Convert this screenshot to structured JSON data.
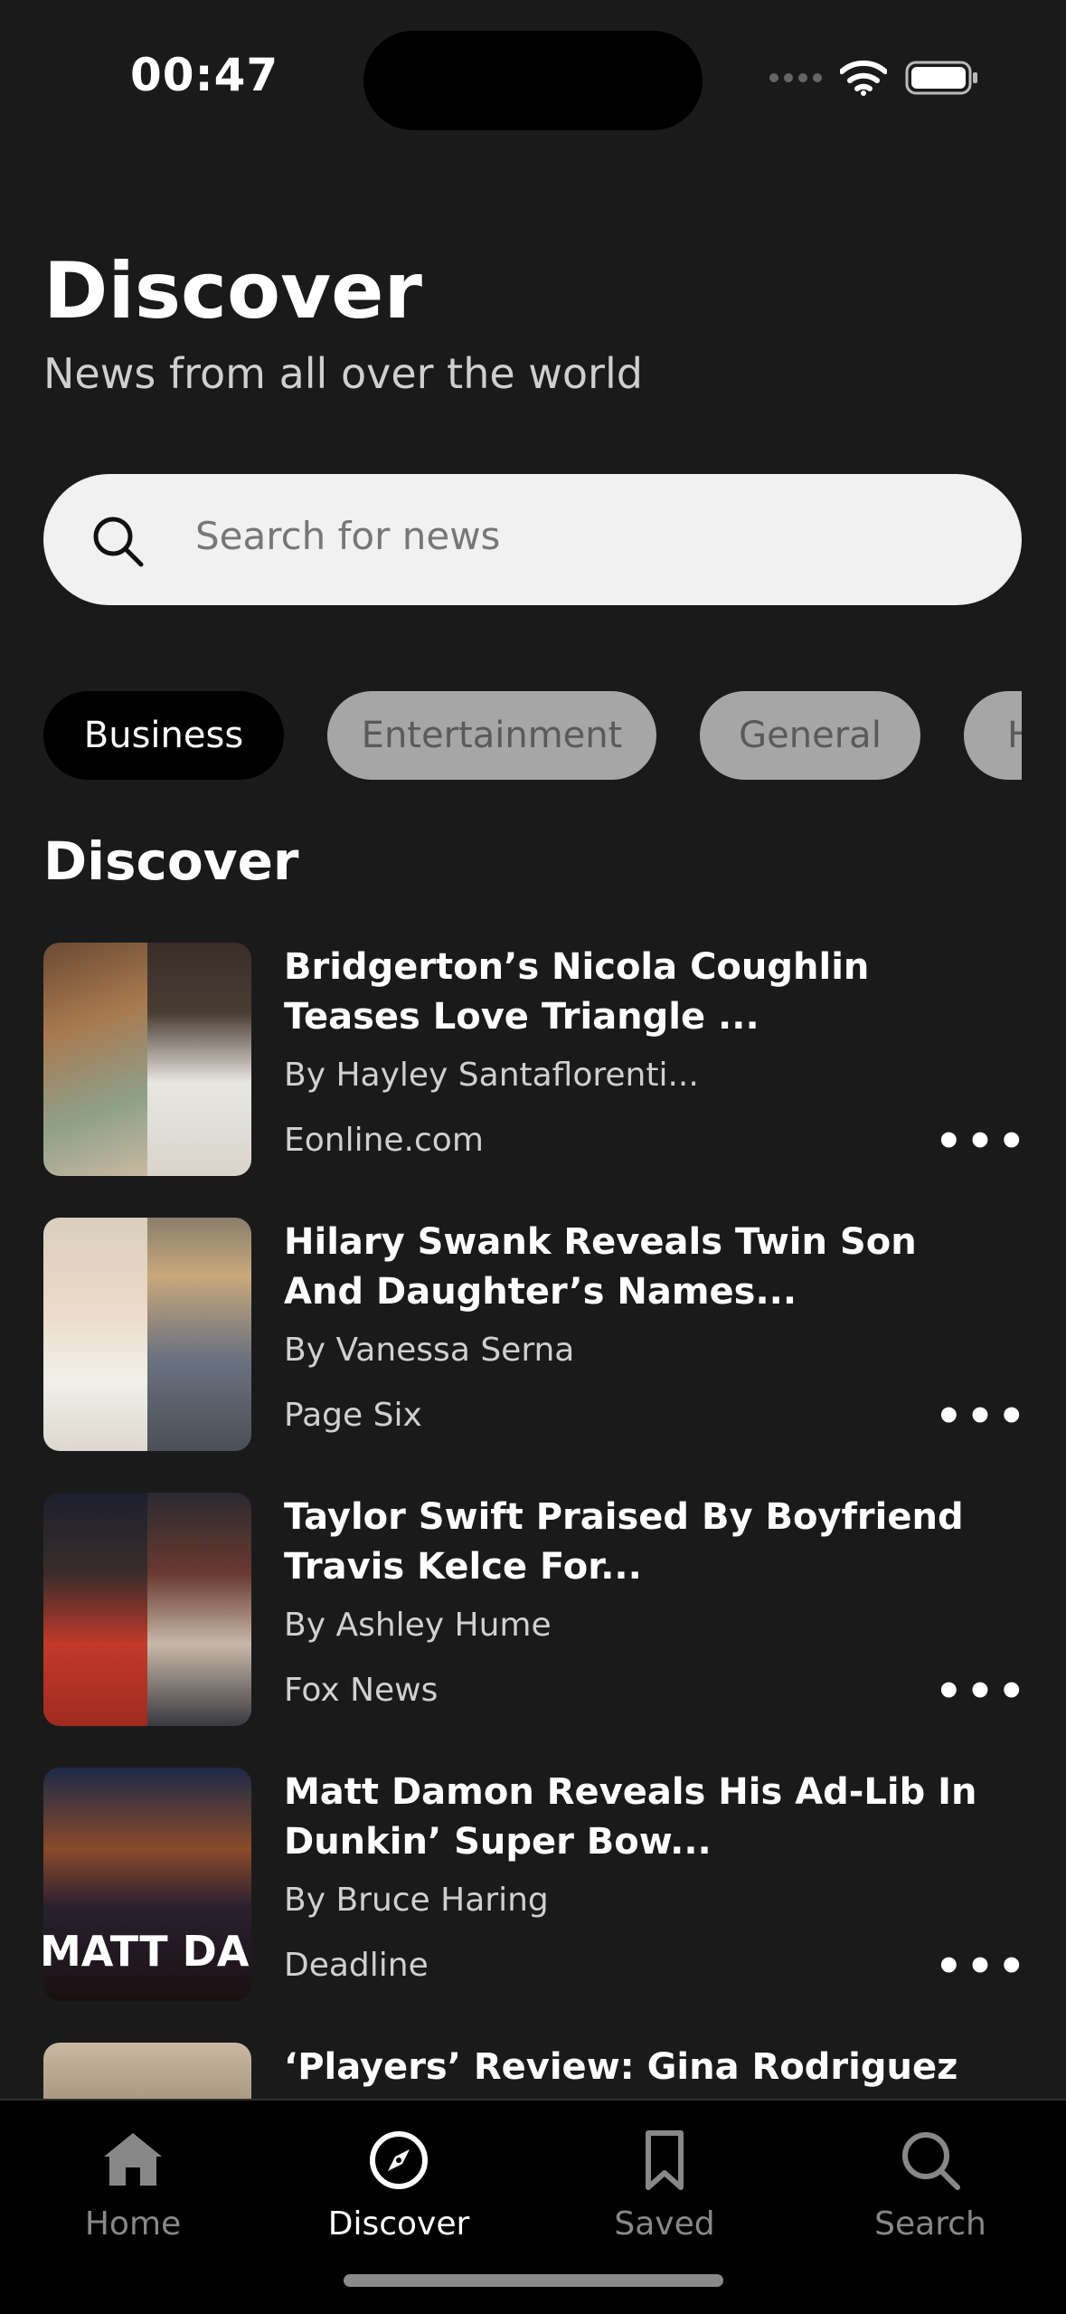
{
  "status": {
    "time": "00:47"
  },
  "header": {
    "title": "Discover",
    "subtitle": "News from all over the world"
  },
  "search": {
    "placeholder": "Search for news"
  },
  "categories": [
    {
      "label": "Business",
      "active": true
    },
    {
      "label": "Entertainment",
      "active": false
    },
    {
      "label": "General",
      "active": false
    },
    {
      "label": "H",
      "active": false
    }
  ],
  "section": {
    "title": "Discover"
  },
  "articles": [
    {
      "headline": "Bridgerton’s Nicola Coughlin Teases Love Triangle ...",
      "author": "By Hayley Santaflorenti...",
      "source": "Eonline.com",
      "more": "•••"
    },
    {
      "headline": "Hilary Swank Reveals Twin Son And Daughter’s Names...",
      "author": "By Vanessa Serna",
      "source": "Page Six",
      "more": "•••"
    },
    {
      "headline": "Taylor Swift Praised By Boyfriend Travis Kelce For...",
      "author": "By Ashley Hume",
      "source": "Fox News",
      "more": "•••"
    },
    {
      "headline": "Matt Damon Reveals His Ad-Lib In Dunkin’ Super Bow...",
      "author": "By Bruce Haring",
      "source": "Deadline",
      "more": "•••",
      "thumb_text": "MATT DAM"
    },
    {
      "headline": "‘Players’ Review: Gina Rodriguez Takes"
    }
  ],
  "tabs": [
    {
      "label": "Home",
      "icon": "home-icon",
      "active": false
    },
    {
      "label": "Discover",
      "icon": "compass-icon",
      "active": true
    },
    {
      "label": "Saved",
      "icon": "bookmark-icon",
      "active": false
    },
    {
      "label": "Search",
      "icon": "search-icon",
      "active": false
    }
  ],
  "colors": {
    "background": "#1a1a1b",
    "chip_active": "#000000",
    "chip_inactive": "#a6a6a6",
    "search_bg": "#f1f1f1"
  }
}
